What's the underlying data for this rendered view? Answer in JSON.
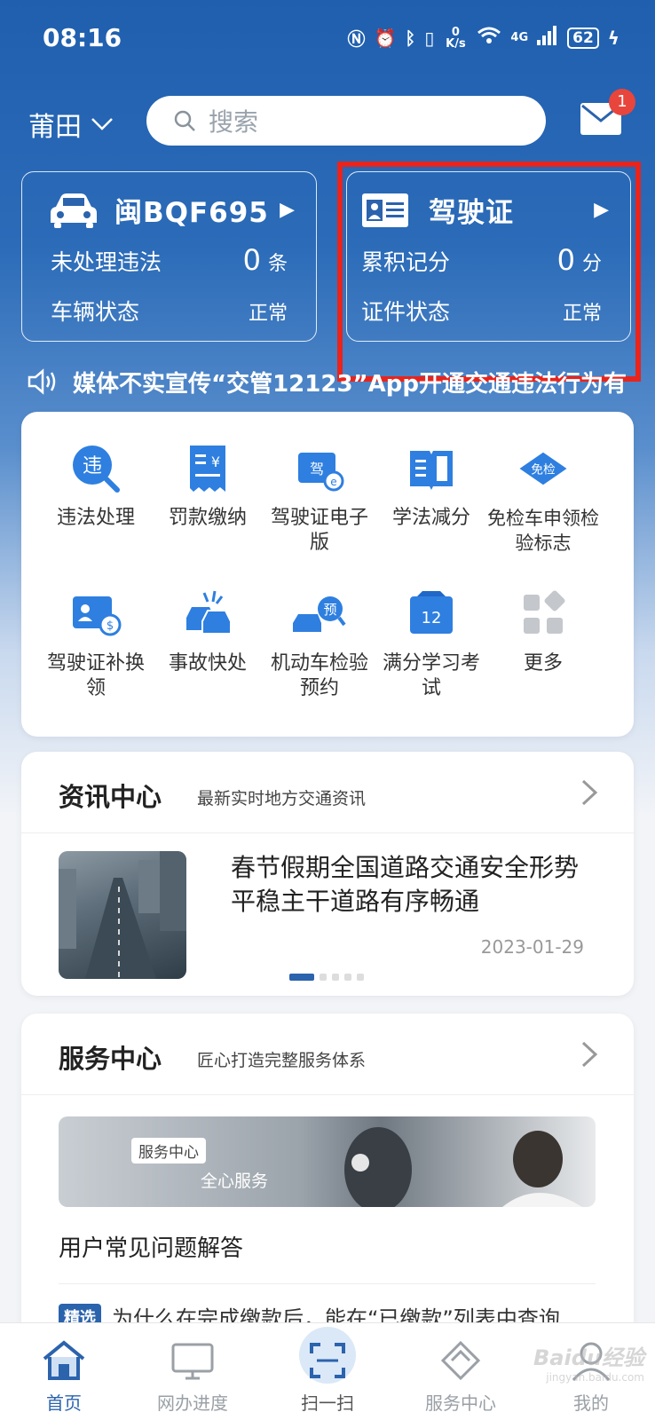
{
  "status_bar": {
    "time": "08:16",
    "net_speed": "0 K/s",
    "network": "4G",
    "battery": "62"
  },
  "top_bar": {
    "city": "莆田",
    "search_placeholder": "搜索",
    "mail_badge": "1"
  },
  "vehicle_card": {
    "plate": "闽BQF695",
    "row1_label": "未处理违法",
    "row1_value": "0",
    "row1_unit": "条",
    "row2_label": "车辆状态",
    "row2_value": "正常"
  },
  "license_card": {
    "title": "驾驶证",
    "row1_label": "累积记分",
    "row1_value": "0",
    "row1_unit": "分",
    "row2_label": "证件状态",
    "row2_value": "正常"
  },
  "ticker": {
    "text": "媒体不实宣传“交管12123”App开通交通违法行为有"
  },
  "services": [
    {
      "label": "违法处理",
      "icon": "violation-search-icon"
    },
    {
      "label": "罚款缴纳",
      "icon": "fine-receipt-icon"
    },
    {
      "label": "驾驶证电子版",
      "icon": "e-license-icon"
    },
    {
      "label": "学法减分",
      "icon": "book-icon"
    },
    {
      "label": "免检车申领检验标志",
      "icon": "exempt-badge-icon",
      "badge": "免检"
    },
    {
      "label": "驾驶证补换领",
      "icon": "license-exchange-icon"
    },
    {
      "label": "事故快处",
      "icon": "accident-icon"
    },
    {
      "label": "机动车检验预约",
      "icon": "inspection-booking-icon",
      "badge": "预"
    },
    {
      "label": "满分学习考试",
      "icon": "calendar-12-icon",
      "badge": "12"
    },
    {
      "label": "更多",
      "icon": "more-grid-icon"
    }
  ],
  "news": {
    "title": "资讯中心",
    "subtitle": "最新实时地方交通资讯",
    "headline": "春节假期全国道路交通安全形势平稳主干道路有序畅通",
    "date": "2023-01-29"
  },
  "service_center": {
    "title": "服务中心",
    "subtitle": "匠心打造完整服务体系",
    "banner_tag": "服务中心",
    "banner_slogan": "全心服务",
    "faq_title": "用户常见问题解答",
    "faq_badge": "精选",
    "faq_item": "为什么在完成缴款后，能在“已缴款”列表中查询..."
  },
  "bottom_nav": [
    {
      "label": "首页",
      "active": true
    },
    {
      "label": "网办进度"
    },
    {
      "label": "扫一扫"
    },
    {
      "label": "服务中心"
    },
    {
      "label": "我的"
    }
  ],
  "watermark": {
    "brand": "Baidu经验",
    "domain": "jingyan.baidu.com"
  },
  "colors": {
    "primary": "#2b63ad",
    "highlight_border": "#e8241c",
    "badge": "#e8453c"
  }
}
